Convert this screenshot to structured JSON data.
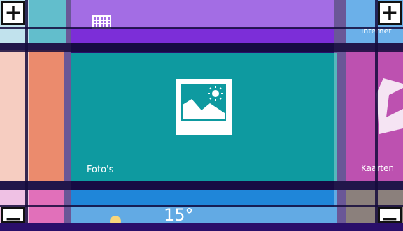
{
  "tiles": {
    "photos_label": "Foto's",
    "internet_label": "Internet",
    "maps_label": "Kaarten",
    "weather_temp": "15°"
  },
  "zoom": {
    "in_label": "+",
    "out_label": "−"
  },
  "icons": {
    "photos": "photos-icon",
    "calendar": "calendar-icon",
    "weather": "weather-icon",
    "maps": "maps-icon"
  },
  "colors": {
    "photos_tile": "#0e9aa0",
    "orange_tile": "#e35a2e",
    "purple_tile": "#7c2ed8",
    "magenta_tile": "#a1068f",
    "blue_tile": "#1f86d9",
    "background": "#2a0f6a"
  }
}
